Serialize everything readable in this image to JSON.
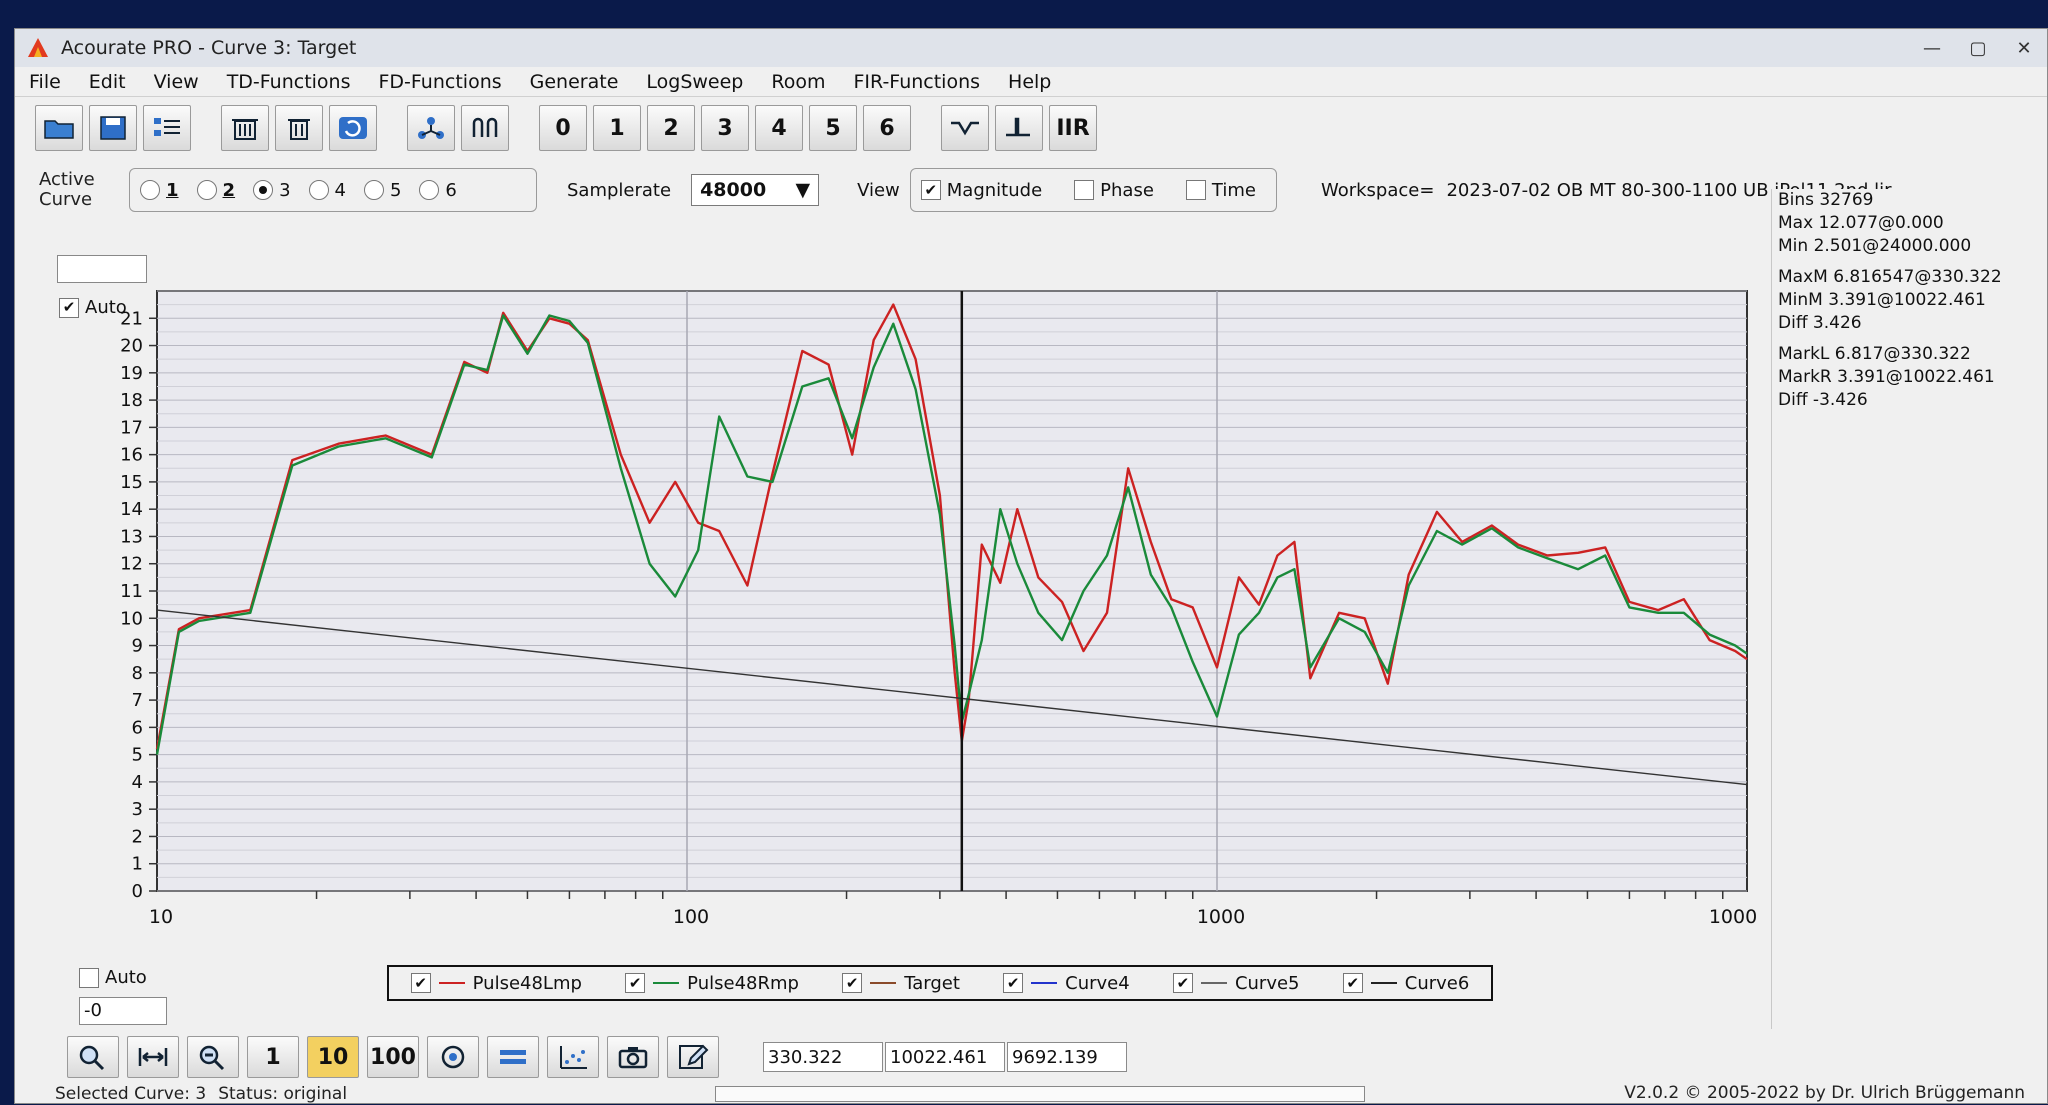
{
  "window": {
    "title": "Acourate PRO - Curve 3: Target",
    "min": "—",
    "max": "▢",
    "close": "✕"
  },
  "menu": [
    "File",
    "Edit",
    "View",
    "TD-Functions",
    "FD-Functions",
    "Generate",
    "LogSweep",
    "Room",
    "FIR-Functions",
    "Help"
  ],
  "toolbar": {
    "num_buttons": [
      "0",
      "1",
      "2",
      "3",
      "4",
      "5",
      "6"
    ],
    "iir": "IIR"
  },
  "options": {
    "active_curve_label": "Active Curve",
    "radios": [
      {
        "label": "1",
        "on": false
      },
      {
        "label": "2",
        "on": false
      },
      {
        "label": "3",
        "on": true
      },
      {
        "label": "4",
        "on": false
      },
      {
        "label": "5",
        "on": false
      },
      {
        "label": "6",
        "on": false
      }
    ],
    "samplerate_label": "Samplerate",
    "samplerate_value": "48000",
    "view_label": "View",
    "view_checks": [
      {
        "label": "Magnitude",
        "checked": true
      },
      {
        "label": "Phase",
        "checked": false
      },
      {
        "label": "Time",
        "checked": false
      }
    ],
    "workspace_label": "Workspace=",
    "workspace_value": "2023-07-02 OB MT 80-300-1100 UB jPol11 2nd lir"
  },
  "plot": {
    "auto_top": "Auto",
    "auto_bottom": "Auto",
    "bottom_field": "-0"
  },
  "legend": [
    {
      "name": "Pulse48Lmp",
      "color": "#cc2222"
    },
    {
      "name": "Pulse48Rmp",
      "color": "#1a8a3a"
    },
    {
      "name": "Target",
      "color": "#8a4a2a"
    },
    {
      "name": "Curve4",
      "color": "#2233cc"
    },
    {
      "name": "Curve5",
      "color": "#666666"
    },
    {
      "name": "Curve6",
      "color": "#222222"
    }
  ],
  "readouts": [
    "Bins 32769",
    "Max 12.077@0.000",
    "Min 2.501@24000.000",
    "MaxM 6.816547@330.322",
    "MinM 3.391@10022.461",
    "Diff 3.426",
    "MarkL 6.817@330.322",
    "MarkR 3.391@10022.461",
    "Diff -3.426"
  ],
  "bottom": {
    "b1": "1",
    "b10": "10",
    "b100": "100",
    "f1": "330.322",
    "f2": "10022.461",
    "f3": "9692.139"
  },
  "status": {
    "selected": "Selected Curve: 3",
    "status": "Status: original",
    "version": "V2.0.2 © 2005-2022 by Dr. Ulrich Brüggemann"
  },
  "chart_data": {
    "type": "line",
    "xscale": "log",
    "xlim": [
      10,
      10000
    ],
    "ylim": [
      0,
      22
    ],
    "x_ticks": [
      "10",
      "100",
      "1000",
      "1000"
    ],
    "y_ticks": [
      "0",
      "1",
      "2",
      "3",
      "4",
      "5",
      "6",
      "7",
      "8",
      "9",
      "10",
      "11",
      "12",
      "13",
      "14",
      "15",
      "16",
      "17",
      "18",
      "19",
      "20",
      "21"
    ],
    "marker_x": 330,
    "series": [
      {
        "name": "Pulse48Lmp",
        "color": "#cc2222",
        "x": [
          10,
          11,
          12,
          15,
          18,
          22,
          27,
          33,
          38,
          42,
          45,
          50,
          55,
          60,
          65,
          75,
          85,
          95,
          105,
          115,
          130,
          145,
          165,
          185,
          205,
          225,
          245,
          270,
          300,
          320,
          330,
          340,
          360,
          390,
          420,
          460,
          510,
          560,
          620,
          680,
          750,
          820,
          900,
          1000,
          1100,
          1200,
          1300,
          1400,
          1500,
          1700,
          1900,
          2100,
          2300,
          2600,
          2900,
          3300,
          3700,
          4200,
          4800,
          5400,
          6000,
          6800,
          7600,
          8500,
          9500,
          10000
        ],
        "y": [
          5.2,
          9.6,
          10.0,
          10.3,
          15.8,
          16.4,
          16.7,
          16.0,
          19.4,
          19.0,
          21.2,
          19.8,
          21.0,
          20.8,
          20.2,
          16.0,
          13.5,
          15.0,
          13.5,
          13.2,
          11.2,
          15.3,
          19.8,
          19.3,
          16.0,
          20.2,
          21.5,
          19.5,
          14.5,
          8.0,
          5.5,
          7.0,
          12.7,
          11.3,
          14.0,
          11.5,
          10.6,
          8.8,
          10.2,
          15.5,
          12.8,
          10.7,
          10.4,
          8.2,
          11.5,
          10.5,
          12.3,
          12.8,
          7.8,
          10.2,
          10.0,
          7.6,
          11.6,
          13.9,
          12.8,
          13.4,
          12.7,
          12.3,
          12.4,
          12.6,
          10.6,
          10.3,
          10.7,
          9.2,
          8.8,
          8.5
        ]
      },
      {
        "name": "Pulse48Rmp",
        "color": "#1a8a3a",
        "x": [
          10,
          11,
          12,
          15,
          18,
          22,
          27,
          33,
          38,
          42,
          45,
          50,
          55,
          60,
          65,
          75,
          85,
          95,
          105,
          115,
          130,
          145,
          165,
          185,
          205,
          225,
          245,
          270,
          300,
          320,
          330,
          340,
          360,
          390,
          420,
          460,
          510,
          560,
          620,
          680,
          750,
          820,
          900,
          1000,
          1100,
          1200,
          1300,
          1400,
          1500,
          1700,
          1900,
          2100,
          2300,
          2600,
          2900,
          3300,
          3700,
          4200,
          4800,
          5400,
          6000,
          6800,
          7600,
          8500,
          9500,
          10000
        ],
        "y": [
          5.0,
          9.5,
          9.9,
          10.2,
          15.6,
          16.3,
          16.6,
          15.9,
          19.3,
          19.1,
          21.1,
          19.7,
          21.1,
          20.9,
          20.1,
          15.5,
          12.0,
          10.8,
          12.5,
          17.4,
          15.2,
          15.0,
          18.5,
          18.8,
          16.6,
          19.2,
          20.8,
          18.4,
          13.8,
          9.0,
          6.2,
          7.2,
          9.2,
          14.0,
          12.0,
          10.2,
          9.2,
          11.0,
          12.3,
          14.8,
          11.6,
          10.4,
          8.4,
          6.4,
          9.4,
          10.2,
          11.5,
          11.8,
          8.2,
          10.0,
          9.5,
          8.0,
          11.2,
          13.2,
          12.7,
          13.3,
          12.6,
          12.2,
          11.8,
          12.3,
          10.4,
          10.2,
          10.2,
          9.4,
          9.0,
          8.7
        ]
      },
      {
        "name": "Target",
        "color": "#333333",
        "x": [
          10,
          10000
        ],
        "y": [
          10.3,
          3.9
        ]
      }
    ]
  }
}
